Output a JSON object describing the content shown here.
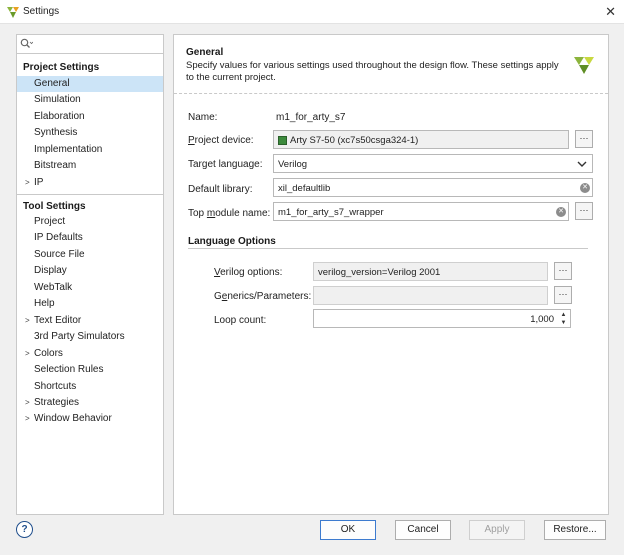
{
  "window": {
    "title": "Settings",
    "close_glyph": "✕"
  },
  "search": {
    "placeholder": "",
    "icon": "search-icon"
  },
  "nav": {
    "project_settings_label": "Project Settings",
    "project_items": [
      {
        "label": "General",
        "selected": true,
        "expandable": false
      },
      {
        "label": "Simulation",
        "expandable": false
      },
      {
        "label": "Elaboration",
        "expandable": false
      },
      {
        "label": "Synthesis",
        "expandable": false
      },
      {
        "label": "Implementation",
        "expandable": false
      },
      {
        "label": "Bitstream",
        "expandable": false
      },
      {
        "label": "IP",
        "expandable": true
      }
    ],
    "tool_settings_label": "Tool Settings",
    "tool_items": [
      {
        "label": "Project",
        "expandable": false
      },
      {
        "label": "IP Defaults",
        "expandable": false
      },
      {
        "label": "Source File",
        "expandable": false
      },
      {
        "label": "Display",
        "expandable": false
      },
      {
        "label": "WebTalk",
        "expandable": false
      },
      {
        "label": "Help",
        "expandable": false
      },
      {
        "label": "Text Editor",
        "expandable": true
      },
      {
        "label": "3rd Party Simulators",
        "expandable": false
      },
      {
        "label": "Colors",
        "expandable": true
      },
      {
        "label": "Selection Rules",
        "expandable": false
      },
      {
        "label": "Shortcuts",
        "expandable": false
      },
      {
        "label": "Strategies",
        "expandable": true
      },
      {
        "label": "Window Behavior",
        "expandable": true
      }
    ]
  },
  "general": {
    "title": "General",
    "description": "Specify values for various settings used throughout the design flow. These settings apply to the current project.",
    "name_label": "Name:",
    "name_value": "m1_for_arty_s7",
    "device_label": "Project device:",
    "device_value": "Arty S7-50 (xc7s50csga324-1)",
    "language_label": "Target language:",
    "language_value": "Verilog",
    "library_label": "Default library:",
    "library_value": "xil_defaultlib",
    "top_label": "Top module name:",
    "top_value": "m1_for_arty_s7_wrapper",
    "dots": "···"
  },
  "language_options": {
    "title": "Language Options",
    "verilog_label": "Verilog options:",
    "verilog_value": "verilog_version=Verilog 2001",
    "generics_label": "Generics/Parameters:",
    "generics_value": "",
    "loop_label": "Loop count:",
    "loop_value": "1,000"
  },
  "buttons": {
    "help": "?",
    "ok": "OK",
    "cancel": "Cancel",
    "apply": "Apply",
    "restore": "Restore..."
  },
  "colors": {
    "selection": "#cce4f7",
    "accent": "#3d7bcf",
    "logo_green": "#8cb43c"
  }
}
